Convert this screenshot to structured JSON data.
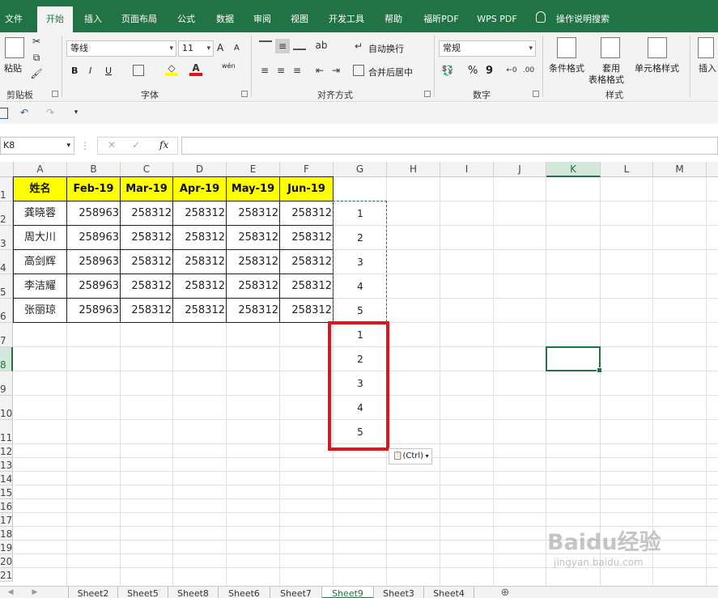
{
  "menu": {
    "tabs": [
      "文件",
      "开始",
      "插入",
      "页面布局",
      "公式",
      "数据",
      "审阅",
      "视图",
      "开发工具",
      "帮助",
      "福昕PDF",
      "WPS PDF",
      "操作说明搜索"
    ],
    "active": "开始"
  },
  "ribbon": {
    "clipboard": {
      "paste": "粘贴",
      "label": "剪贴板"
    },
    "font": {
      "name": "等线",
      "size": "11",
      "grow": "A",
      "shrink": "A",
      "bold": "B",
      "italic": "I",
      "underline": "U",
      "label": "字体",
      "wen": "wén"
    },
    "alignment": {
      "wrap": "自动换行",
      "merge": "合并后居中",
      "label": "对齐方式"
    },
    "number": {
      "format": "常规",
      "percent": "%",
      "comma": "9",
      "label": "数字"
    },
    "styles": {
      "conditional": "条件格式",
      "table_a": "套用",
      "table_b": "表格格式",
      "cell_styles": "单元格样式",
      "label": "样式"
    },
    "cells": {
      "insert": "插入"
    }
  },
  "formula_bar": {
    "name_box": "K8",
    "fx": "fx",
    "formula": ""
  },
  "sheet": {
    "columns": [
      "A",
      "B",
      "C",
      "D",
      "E",
      "F",
      "G",
      "H",
      "I",
      "J",
      "K",
      "L",
      "M"
    ],
    "rows": [
      "1",
      "2",
      "3",
      "4",
      "5",
      "6",
      "7",
      "8",
      "9",
      "10",
      "11",
      "12",
      "13",
      "14",
      "15",
      "16",
      "17",
      "18",
      "19",
      "20",
      "21"
    ],
    "selected_cell": "K8",
    "header_row": [
      "姓名",
      "Feb-19",
      "Mar-19",
      "Apr-19",
      "May-19",
      "Jun-19"
    ],
    "data_rows": [
      [
        "龚晓蓉",
        "258963",
        "258312",
        "258312",
        "258312",
        "258312"
      ],
      [
        "周大川",
        "258963",
        "258312",
        "258312",
        "258312",
        "258312"
      ],
      [
        "高剑辉",
        "258963",
        "258312",
        "258312",
        "258312",
        "258312"
      ],
      [
        "李洁耀",
        "258963",
        "258312",
        "258312",
        "258312",
        "258312"
      ],
      [
        "张丽琼",
        "258963",
        "258312",
        "258312",
        "258312",
        "258312"
      ]
    ],
    "g_copied": [
      "1",
      "2",
      "3",
      "4",
      "5"
    ],
    "g_pasted": [
      "1",
      "2",
      "3",
      "4",
      "5"
    ],
    "paste_options": "(Ctrl)"
  },
  "sheet_tabs": [
    "Sheet2",
    "Sheet5",
    "Sheet8",
    "Sheet6",
    "Sheet7",
    "Sheet9",
    "Sheet3",
    "Sheet4"
  ],
  "active_sheet": "Sheet9",
  "watermark": {
    "logo": "Baidu经验",
    "url": "jingyan.baidu.com"
  },
  "colors": {
    "brand": "#217346",
    "highlight": "#ffff00",
    "annotation": "#e0151b"
  }
}
